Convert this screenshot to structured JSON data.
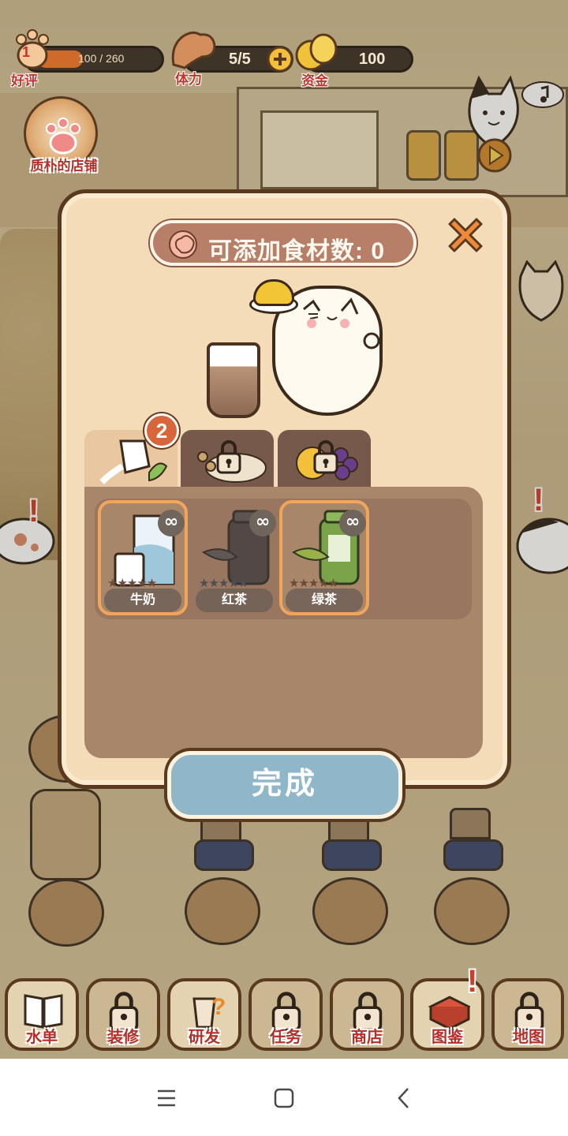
{
  "hud": {
    "rating": {
      "label": "好评",
      "value": "100 / 260",
      "level": "1",
      "progress": 0.385
    },
    "stamina": {
      "label": "体力",
      "value": "5/5"
    },
    "funds": {
      "label": "资金",
      "value": "100"
    }
  },
  "shop": {
    "name": "质朴的店铺"
  },
  "dialog": {
    "ingredient_slots_label": "可添加食材数: 0",
    "tab_badge_count": "2",
    "tabs": [
      {
        "id": "liquids",
        "icon": "milk-pour-icon",
        "active": true,
        "locked": false
      },
      {
        "id": "toppings",
        "icon": "pearls-icon",
        "active": false,
        "locked": true
      },
      {
        "id": "fruits",
        "icon": "fruit-icon",
        "active": false,
        "locked": true
      }
    ],
    "ingredients": [
      {
        "name": "牛奶",
        "selected": true,
        "stars_lit": 0,
        "stars_total": 5,
        "quantity": "∞",
        "icon": "milk-carton-icon"
      },
      {
        "name": "红茶",
        "selected": false,
        "stars_lit": 0,
        "stars_total": 5,
        "quantity": "∞",
        "icon": "black-tea-icon"
      },
      {
        "name": "绿茶",
        "selected": true,
        "stars_lit": 0,
        "stars_total": 5,
        "quantity": "∞",
        "icon": "green-tea-icon"
      }
    ],
    "done_label": "完成"
  },
  "bottom_nav": [
    {
      "label": "水单",
      "locked": false,
      "icon": "menu-book-icon"
    },
    {
      "label": "装修",
      "locked": true,
      "icon": "decorate-icon"
    },
    {
      "label": "研发",
      "locked": false,
      "icon": "research-cup-icon"
    },
    {
      "label": "任务",
      "locked": true,
      "icon": "tasks-icon"
    },
    {
      "label": "商店",
      "locked": true,
      "icon": "store-icon"
    },
    {
      "label": "图鉴",
      "locked": false,
      "icon": "catalog-icon",
      "alert": true
    },
    {
      "label": "地图",
      "locked": true,
      "icon": "map-icon"
    }
  ],
  "colors": {
    "accent_orange": "#f0a55a",
    "done_button": "#8fb7c9",
    "label_red": "#b3312a"
  }
}
